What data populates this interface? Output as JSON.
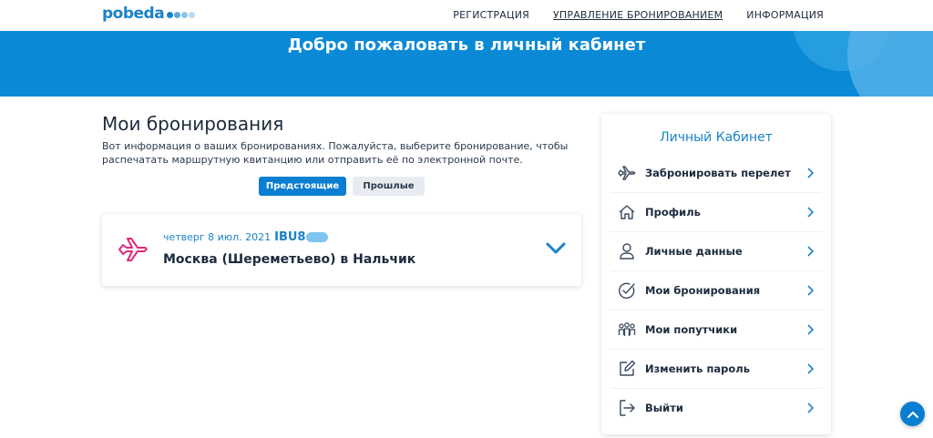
{
  "header": {
    "logo_text": "pobeda",
    "nav": [
      {
        "label": "РЕГИСТРАЦИЯ"
      },
      {
        "label": "УПРАВЛЕНИЕ БРОНИРОВАНИЕМ"
      },
      {
        "label": "ИНФОРМАЦИЯ"
      }
    ]
  },
  "banner": {
    "title": "Добро пожаловать в личный кабинет"
  },
  "main": {
    "title": "Мои бронирования",
    "description": "Вот информация о ваших бронированиях. Пожалуйста, выберите бронирование, чтобы распечатать маршрутную квитанцию или отправить её по электронной почте.",
    "tabs": [
      {
        "label": "Предстоящие",
        "active": true
      },
      {
        "label": "Прошлые",
        "active": false
      }
    ],
    "booking": {
      "date": "четверг 8 июл. 2021",
      "code": "IBU8",
      "route": "Москва (Шереметьево)  в  Нальчик",
      "icon": "plane-icon"
    }
  },
  "sidebar": {
    "title": "Личный Кабинет",
    "items": [
      {
        "label": "Забронировать перелет",
        "icon": "plane-icon"
      },
      {
        "label": "Профиль",
        "icon": "home-icon"
      },
      {
        "label": "Личные данные",
        "icon": "user-icon"
      },
      {
        "label": "Мои бронирования",
        "icon": "check-circle-icon"
      },
      {
        "label": "Мои попутчики",
        "icon": "group-icon"
      },
      {
        "label": "Изменить пароль",
        "icon": "edit-icon"
      },
      {
        "label": "Выйти",
        "icon": "logout-icon"
      }
    ]
  },
  "colors": {
    "brand_blue": "#0a8ad6",
    "accent_pink": "#e0297c",
    "text_dark": "#1d2b3e"
  }
}
